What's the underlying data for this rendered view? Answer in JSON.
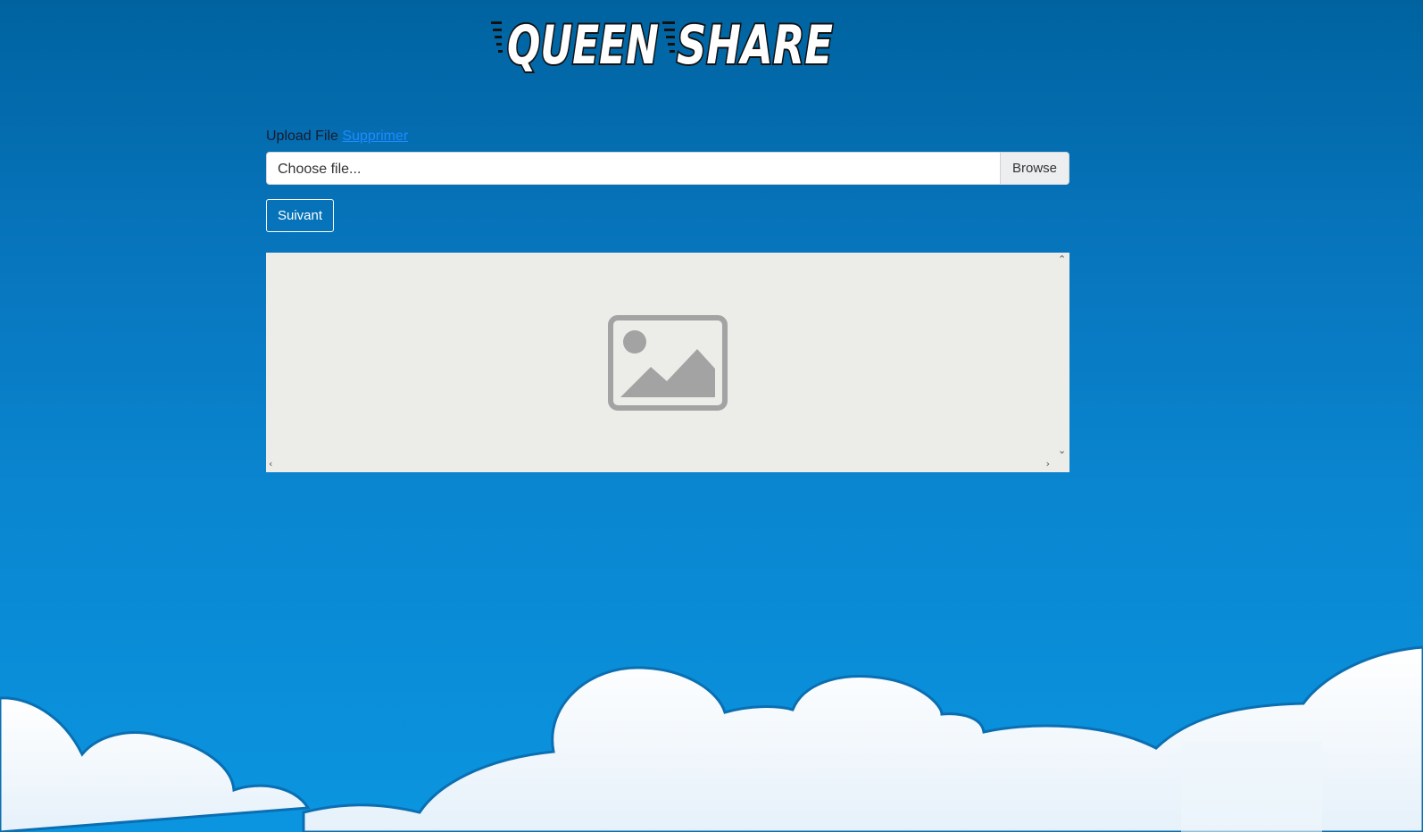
{
  "brand": {
    "logo_text": "QUEEN SHARE"
  },
  "upload": {
    "label": "Upload File",
    "remove_link": "Supprimer",
    "file_placeholder": "Choose file...",
    "browse_label": "Browse"
  },
  "actions": {
    "next_label": "Suivant"
  },
  "preview": {
    "icon": "image-placeholder-icon"
  },
  "colors": {
    "sky_top": "#0063a0",
    "sky_bottom": "#0b95e0",
    "link": "#1e8bff",
    "preview_bg": "#ecece8"
  }
}
